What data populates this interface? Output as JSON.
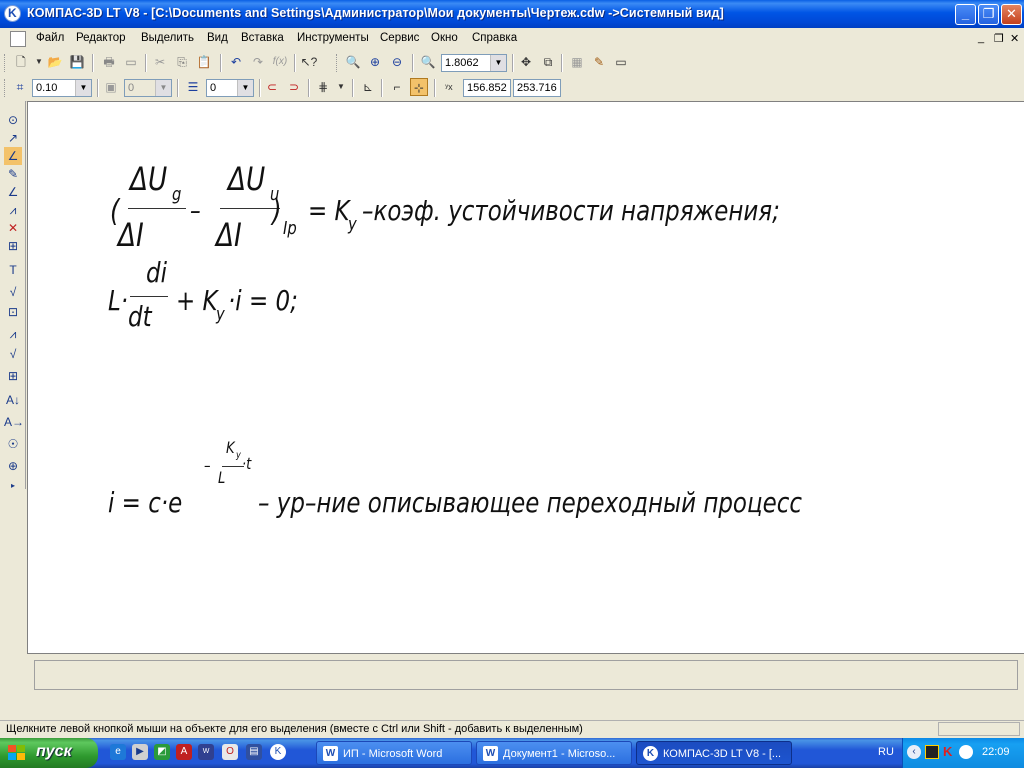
{
  "window": {
    "title": "КОМПАС-3D LT V8 - [C:\\Documents and Settings\\Администратор\\Мои документы\\Чертеж.cdw ->Системный вид]"
  },
  "menu": {
    "items": [
      "Файл",
      "Редактор",
      "Выделить",
      "Вид",
      "Вставка",
      "Инструменты",
      "Сервис",
      "Окно",
      "Справка"
    ]
  },
  "toolbar": {
    "zoom_value": "1.8062",
    "line_width": "0.10",
    "layer_value": "0",
    "style_value": "0",
    "coord_x": "156.852",
    "coord_y": "253.716"
  },
  "canvas": {
    "eq1_frac1_num": "ΔU",
    "eq1_frac1_num_sub": "g",
    "eq1_frac2_num": "ΔU",
    "eq1_frac2_num_sub": "u",
    "eq1_den1": "ΔI",
    "eq1_den2": "ΔI",
    "eq1_open": "(",
    "eq1_minus": "–",
    "eq1_close": ")",
    "eq1_close_sub": "Ip",
    "eq1_eq": "= K",
    "eq1_eq_sub": "y",
    "eq1_text": "–коэф. устойчивости напряжения;",
    "eq2_L": "L·",
    "eq2_num": "di",
    "eq2_den": "dt",
    "eq2_rest": "+ K",
    "eq2_rest_sub": "y",
    "eq2_tail": "·i = 0;",
    "eq3_main": "i = c·e",
    "eq3_exp_minus": "–",
    "eq3_exp_num": "K",
    "eq3_exp_num_sub": "y",
    "eq3_exp_den": "L",
    "eq3_exp_t": "·t",
    "eq3_text": "– ур–ние описывающее переходный процесс"
  },
  "status": {
    "hint": "Щелкните левой кнопкой мыши на объекте для его выделения (вместе с Ctrl или Shift - добавить к выделенным)"
  },
  "taskbar": {
    "start_label": "пуск",
    "items": [
      "ИП - Microsoft Word",
      "Документ1 - Microso...",
      "КОМПАС-3D LT V8 - [..."
    ],
    "lang": "RU",
    "clock": "22:09"
  }
}
